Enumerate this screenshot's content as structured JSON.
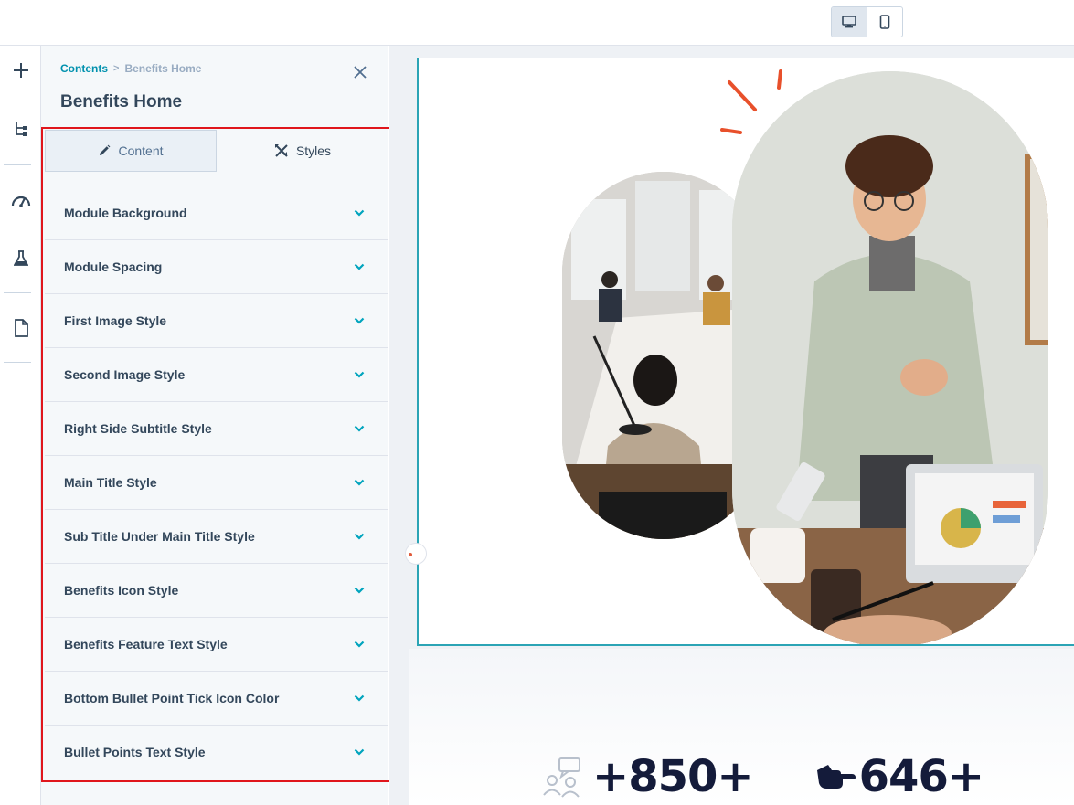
{
  "colors": {
    "accent": "#00a4bd",
    "link": "#0091ae",
    "highlight": "#e0161c",
    "preview_border": "#2ba4b5",
    "stat_text": "#141b3a",
    "burst": "#e8502b"
  },
  "topbar": {
    "device_buttons": [
      {
        "icon": "desktop-icon",
        "active": true
      },
      {
        "icon": "mobile-icon",
        "active": false
      }
    ]
  },
  "rail": {
    "icons": [
      "plus-icon",
      "tree-icon",
      "speedometer-icon",
      "flask-icon",
      "page-icon"
    ]
  },
  "panel": {
    "breadcrumb": {
      "root": "Contents",
      "separator": ">",
      "current": "Benefits Home"
    },
    "title": "Benefits Home",
    "tabs": [
      {
        "label": "Content",
        "icon": "pencil-icon",
        "active": false
      },
      {
        "label": "Styles",
        "icon": "styles-icon",
        "active": true
      }
    ],
    "sections": [
      "Module Background",
      "Module Spacing",
      "First Image Style",
      "Second Image Style",
      "Right Side Subtitle Style",
      "Main Title Style",
      "Sub Title Under Main Title Style",
      "Benefits Icon Style",
      "Benefits Feature Text Style",
      "Bottom Bullet Point Tick Icon Color",
      "Bullet Points Text Style"
    ]
  },
  "preview": {
    "stats": [
      {
        "icon": "people-chat-icon",
        "value": "+850+"
      },
      {
        "icon": "pointing-hand-icon",
        "value": "646+"
      }
    ]
  }
}
